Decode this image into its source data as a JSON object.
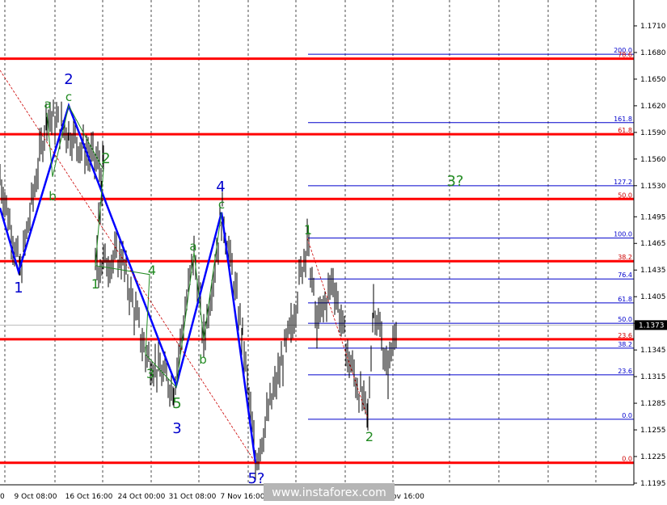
{
  "chart_data": {
    "type": "candlestick",
    "symbol_price_scale": {
      "ylim": [
        1.1195,
        1.174
      ],
      "ticks": [
        "1.1710",
        "1.1680",
        "1.1650",
        "1.1620",
        "1.1590",
        "1.1560",
        "1.1530",
        "1.1495",
        "1.1465",
        "1.1435",
        "1.1405",
        "1.1375",
        "1.1345",
        "1.1315",
        "1.1285",
        "1.1255",
        "1.1225",
        "1.1195"
      ],
      "current_price": "1.1373"
    },
    "time_ticks": [
      "0",
      "9 Oct 08:00",
      "16 Oct 16:00",
      "24 Oct 00:00",
      "31 Oct 08:00",
      "7 Nov 16:00",
      "",
      "ov 16:00"
    ],
    "horizontal_levels": [
      1.1673,
      1.1588,
      1.1515,
      1.1445,
      1.1357,
      1.1218
    ],
    "fib_levels_right": [
      {
        "label": "200.0",
        "price": 1.1678,
        "color": "#0000cc"
      },
      {
        "label": "78.6",
        "price": 1.1673,
        "color": "#cc0000"
      },
      {
        "label": "161.8",
        "price": 1.1601,
        "color": "#0000cc"
      },
      {
        "label": "61.8",
        "price": 1.1588,
        "color": "#cc0000"
      },
      {
        "label": "127.2",
        "price": 1.153,
        "color": "#0000cc"
      },
      {
        "label": "50.0",
        "price": 1.1515,
        "color": "#cc0000"
      },
      {
        "label": "100.0",
        "price": 1.1471,
        "color": "#0000cc"
      },
      {
        "label": "38.2",
        "price": 1.1445,
        "color": "#cc0000"
      },
      {
        "label": "76.4",
        "price": 1.1425,
        "color": "#0000cc"
      },
      {
        "label": "61.8",
        "price": 1.1398,
        "color": "#0000cc"
      },
      {
        "label": "50.0",
        "price": 1.1375,
        "color": "#0000cc"
      },
      {
        "label": "23.6",
        "price": 1.1357,
        "color": "#cc0000"
      },
      {
        "label": "38.2",
        "price": 1.1347,
        "color": "#0000cc"
      },
      {
        "label": "23.6",
        "price": 1.1317,
        "color": "#0000cc"
      },
      {
        "label": "0.0",
        "price": 1.1267,
        "color": "#0000cc"
      },
      {
        "label": "0.0",
        "price": 1.1218,
        "color": "#cc0000"
      }
    ],
    "wave_labels": [
      {
        "text": "2",
        "color": "#0000cc"
      },
      {
        "text": "a",
        "color": "#228b22"
      },
      {
        "text": "c",
        "color": "#228b22"
      },
      {
        "text": "b",
        "color": "#228b22"
      },
      {
        "text": "1",
        "color": "#0000cc"
      },
      {
        "text": "2",
        "color": "#228b22"
      },
      {
        "text": "1",
        "color": "#228b22"
      },
      {
        "text": "4",
        "color": "#228b22"
      },
      {
        "text": "3",
        "color": "#228b22"
      },
      {
        "text": "5",
        "color": "#228b22"
      },
      {
        "text": "3",
        "color": "#0000cc"
      },
      {
        "text": "a",
        "color": "#228b22"
      },
      {
        "text": "b",
        "color": "#228b22"
      },
      {
        "text": "4",
        "color": "#0000cc"
      },
      {
        "text": "c",
        "color": "#228b22"
      },
      {
        "text": "5?",
        "color": "#0000cc"
      },
      {
        "text": "1",
        "color": "#228b22"
      },
      {
        "text": "2",
        "color": "#228b22"
      },
      {
        "text": "3?",
        "color": "#228b22"
      }
    ],
    "wave_path_prices": [
      1.1455,
      1.1433,
      1.162,
      1.1465,
      1.1305,
      1.15,
      1.1218
    ]
  },
  "watermark": "www.instaforex.com",
  "colors": {
    "level": "#ff0000",
    "fib_blue": "#0000cc",
    "wave_blue": "#0000ff",
    "wave_green": "#228b22",
    "axis": "#000000"
  }
}
